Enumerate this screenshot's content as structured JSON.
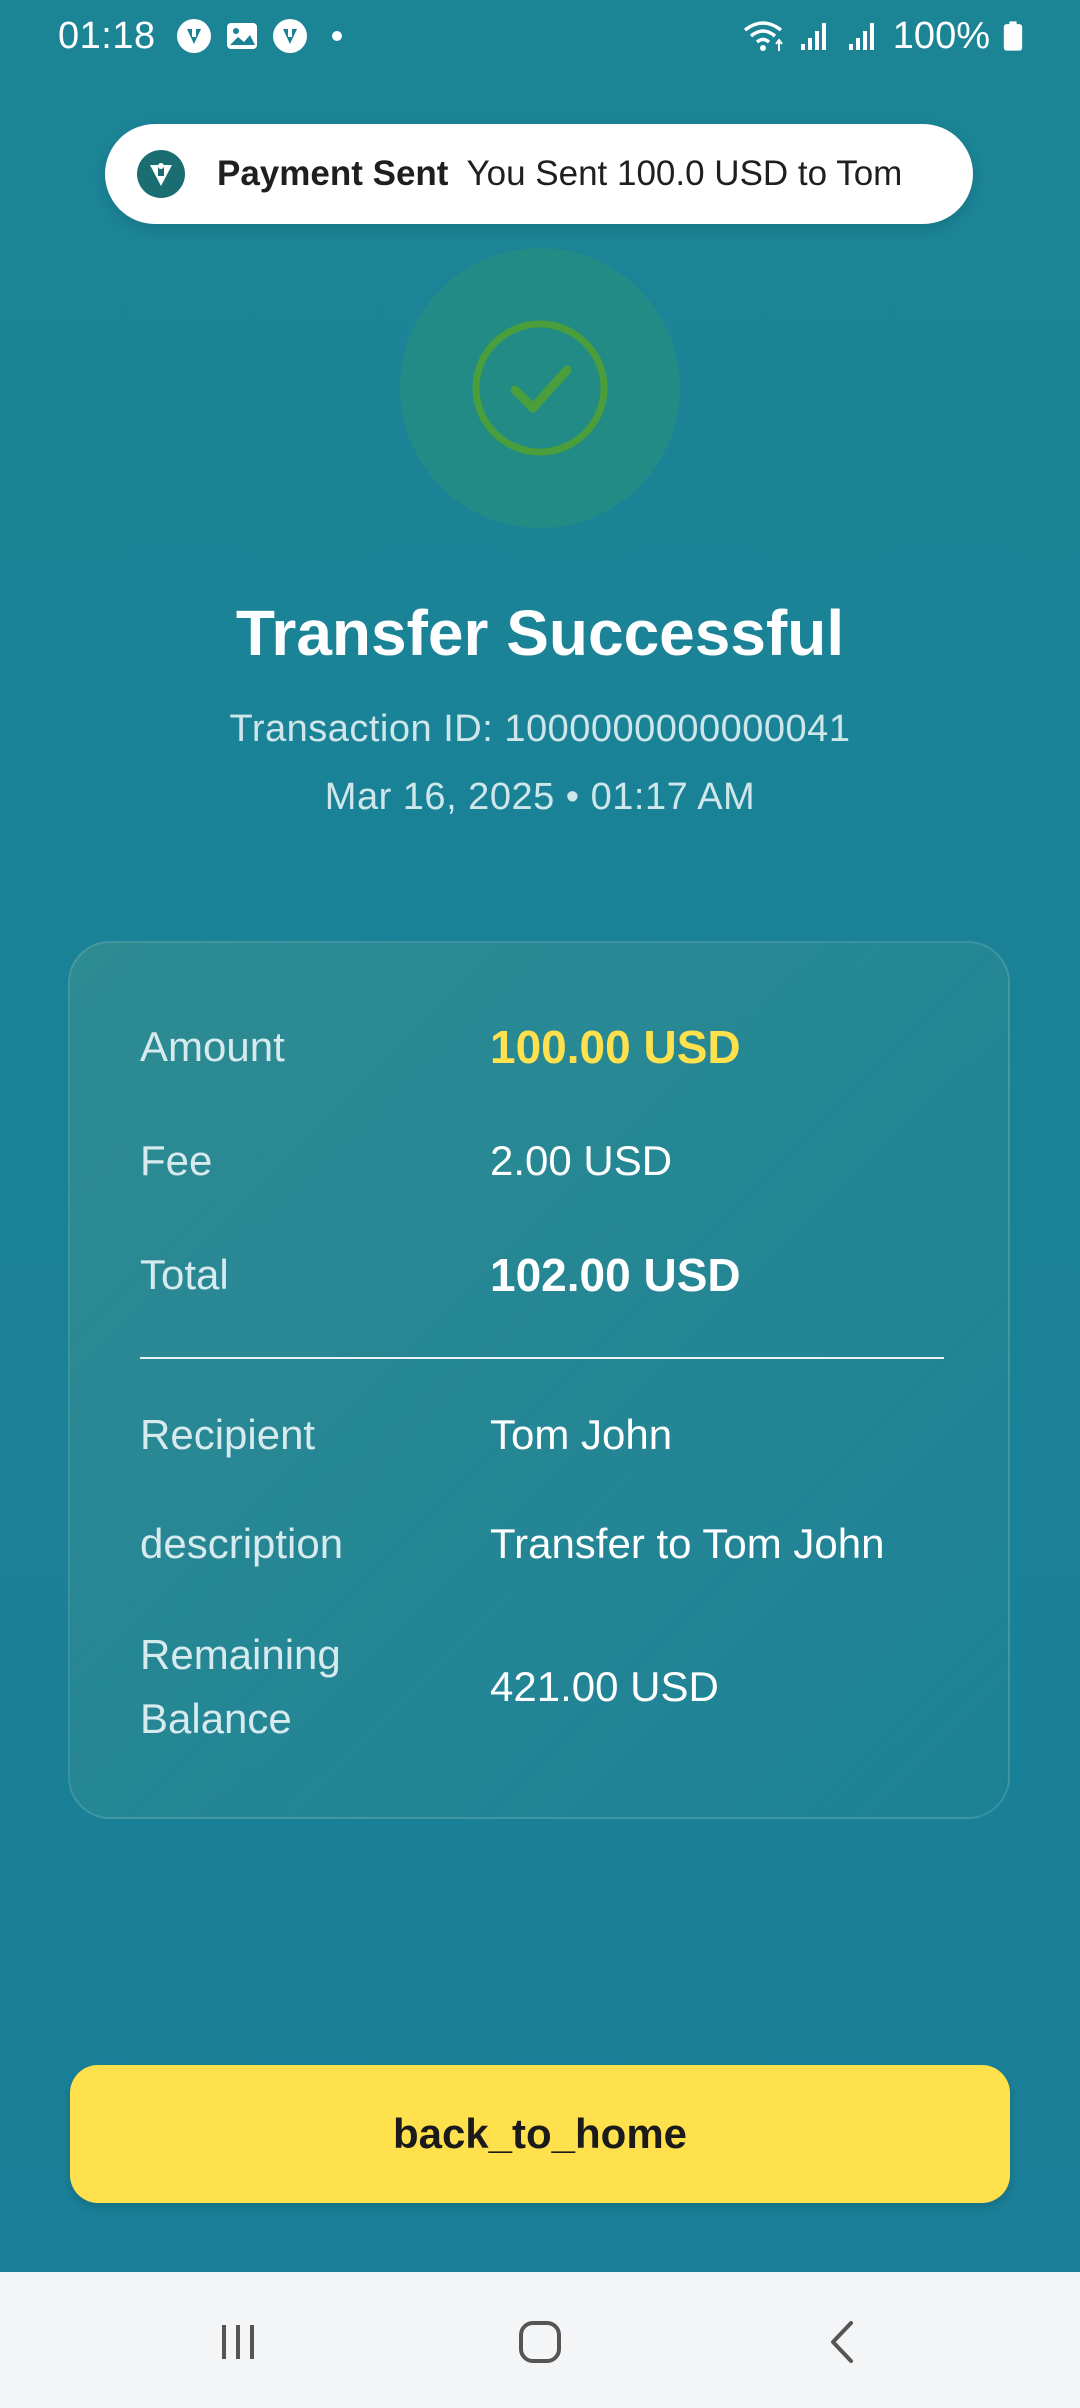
{
  "status_bar": {
    "time": "01:18",
    "battery": "100%",
    "icons": [
      "app-notification-icon",
      "image-icon",
      "app-notification-icon",
      "dot",
      "wifi-icon",
      "signal-icon",
      "signal-icon",
      "battery-icon"
    ]
  },
  "toast": {
    "title": "Payment Sent",
    "message": "You Sent 100.0 USD to Tom",
    "icon": "app-logo-icon"
  },
  "header": {
    "title": "Transfer Successful",
    "transaction_id": "Transaction ID: 1000000000000041",
    "datetime": "Mar 16, 2025 • 01:17 AM",
    "status_icon": "check-circle-icon"
  },
  "details": {
    "amount_label": "Amount",
    "amount_value": "100.00 USD",
    "fee_label": "Fee",
    "fee_value": "2.00 USD",
    "total_label": "Total",
    "total_value": "102.00 USD",
    "recipient_label": "Recipient",
    "recipient_value": "Tom John",
    "description_label": "description",
    "description_value": "Transfer to Tom John",
    "balance_label_line1": "Remaining",
    "balance_label_line2": "Balance",
    "balance_value": "421.00 USD"
  },
  "actions": {
    "home_button_label": "back_to_home"
  },
  "colors": {
    "background": "#1b8295",
    "accent": "#ffe04d",
    "success": "#4caf50"
  }
}
